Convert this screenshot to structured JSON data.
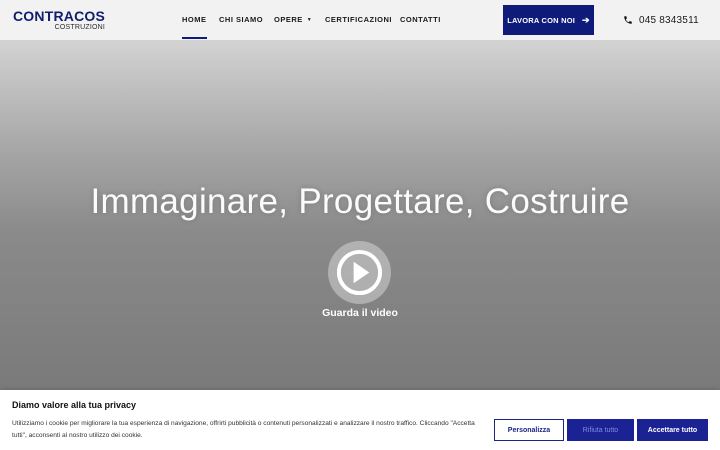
{
  "logo": {
    "main": "CONTRACOS",
    "sub": "COSTRUZIONI"
  },
  "nav": {
    "items": [
      {
        "label": "HOME",
        "active": true
      },
      {
        "label": "CHI SIAMO"
      },
      {
        "label": "OPERE",
        "dropdown": true
      },
      {
        "label": "CERTIFICAZIONI"
      },
      {
        "label": "CONTATTI"
      }
    ],
    "cta_label": "LAVORA CON NOI",
    "cta_icon": "arrow-right-icon",
    "phone_icon": "phone-icon",
    "phone": "045 8343511"
  },
  "hero": {
    "title": "Immaginare, Progettare, Costruire",
    "play_icon": "play-icon",
    "video_label": "Guarda il video"
  },
  "cookie": {
    "title": "Diamo valore alla tua privacy",
    "text": "Utilizziamo i cookie per migliorare la tua esperienza di navigazione, offrirti pubblicità o contenuti personalizzati e analizzare il nostro traffico. Cliccando \"Accetta tutti\", acconsenti al nostro utilizzo dei cookie.",
    "customize": "Personalizza",
    "reject": "Rifiuta tutto",
    "accept": "Accettare tutto"
  },
  "colors": {
    "brand": "#0f1b7b",
    "header_bg": "#f2f2f2",
    "text": "#1b1b1b"
  }
}
